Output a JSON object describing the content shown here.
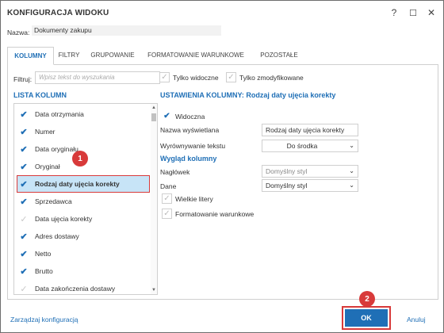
{
  "window": {
    "title": "KONFIGURACJA WIDOKU",
    "help_symbol": "?",
    "maximize_symbol": "☐",
    "close_symbol": "✕"
  },
  "name": {
    "label": "Nazwa:",
    "value": "Dokumenty zakupu"
  },
  "tabs": [
    {
      "label": "KOLUMNY",
      "active": true
    },
    {
      "label": "FILTRY",
      "active": false
    },
    {
      "label": "GRUPOWANIE",
      "active": false
    },
    {
      "label": "FORMATOWANIE WARUNKOWE",
      "active": false
    },
    {
      "label": "POZOSTAŁE",
      "active": false
    }
  ],
  "filter": {
    "label": "Filtruj:",
    "placeholder": "Wpisz tekst do wyszukania",
    "only_visible": "Tylko widoczne",
    "only_modified": "Tylko zmodyfikowane"
  },
  "column_list": {
    "title": "LISTA KOLUMN",
    "items": [
      {
        "label": "Data otrzymania",
        "checked": true
      },
      {
        "label": "Numer",
        "checked": true
      },
      {
        "label": "Data oryginału",
        "checked": true
      },
      {
        "label": "Oryginał",
        "checked": true
      },
      {
        "label": "Rodzaj daty ujęcia korekty",
        "checked": true,
        "selected": true
      },
      {
        "label": "Sprzedawca",
        "checked": true
      },
      {
        "label": "Data ujęcia korekty",
        "checked": false
      },
      {
        "label": "Adres dostawy",
        "checked": true
      },
      {
        "label": "Netto",
        "checked": true
      },
      {
        "label": "Brutto",
        "checked": true
      },
      {
        "label": "Data zakończenia dostawy",
        "checked": false
      }
    ]
  },
  "settings": {
    "title": "USTAWIENIA KOLUMNY: Rodzaj daty ujęcia korekty",
    "visible_label": "Widoczna",
    "display_name_label": "Nazwa wyświetlana",
    "display_name_value": "Rodzaj daty ujęcia korekty",
    "align_label": "Wyrównywanie tekstu",
    "align_value": "Do środka",
    "appearance_title": "Wygląd kolumny",
    "header_label": "Nagłówek",
    "header_value": "Domyślny styl",
    "data_label": "Dane",
    "data_value": "Domyślny styl",
    "uppercase_label": "Wielkie litery",
    "conditional_label": "Formatowanie warunkowe"
  },
  "footer": {
    "manage_link": "Zarządzaj konfiguracją",
    "ok_label": "OK",
    "cancel_label": "Anuluj"
  },
  "annotations": {
    "badge1": "1",
    "badge2": "2"
  },
  "colors": {
    "accent": "#1f6fb6",
    "highlight": "#d83a3a",
    "selection": "#c7e4f7"
  }
}
